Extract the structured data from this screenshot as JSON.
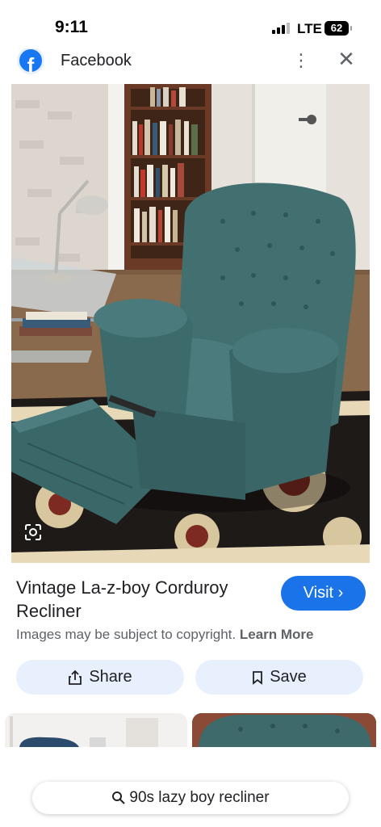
{
  "status_bar": {
    "time": "9:11",
    "network": "LTE",
    "battery": "62"
  },
  "source": {
    "name": "Facebook"
  },
  "image": {
    "subject": "green corduroy recliner"
  },
  "result": {
    "title": "Vintage La-z-boy Corduroy Recliner",
    "visit_label": "Visit",
    "copyright_notice": "Images may be subject to copyright.",
    "learn_more_label": "Learn More",
    "share_label": "Share",
    "save_label": "Save"
  },
  "search": {
    "query": "90s lazy boy recliner"
  },
  "colors": {
    "accent": "#1a73e8",
    "button_bg": "#e8f0fe",
    "chair": "#3f6b6c"
  }
}
